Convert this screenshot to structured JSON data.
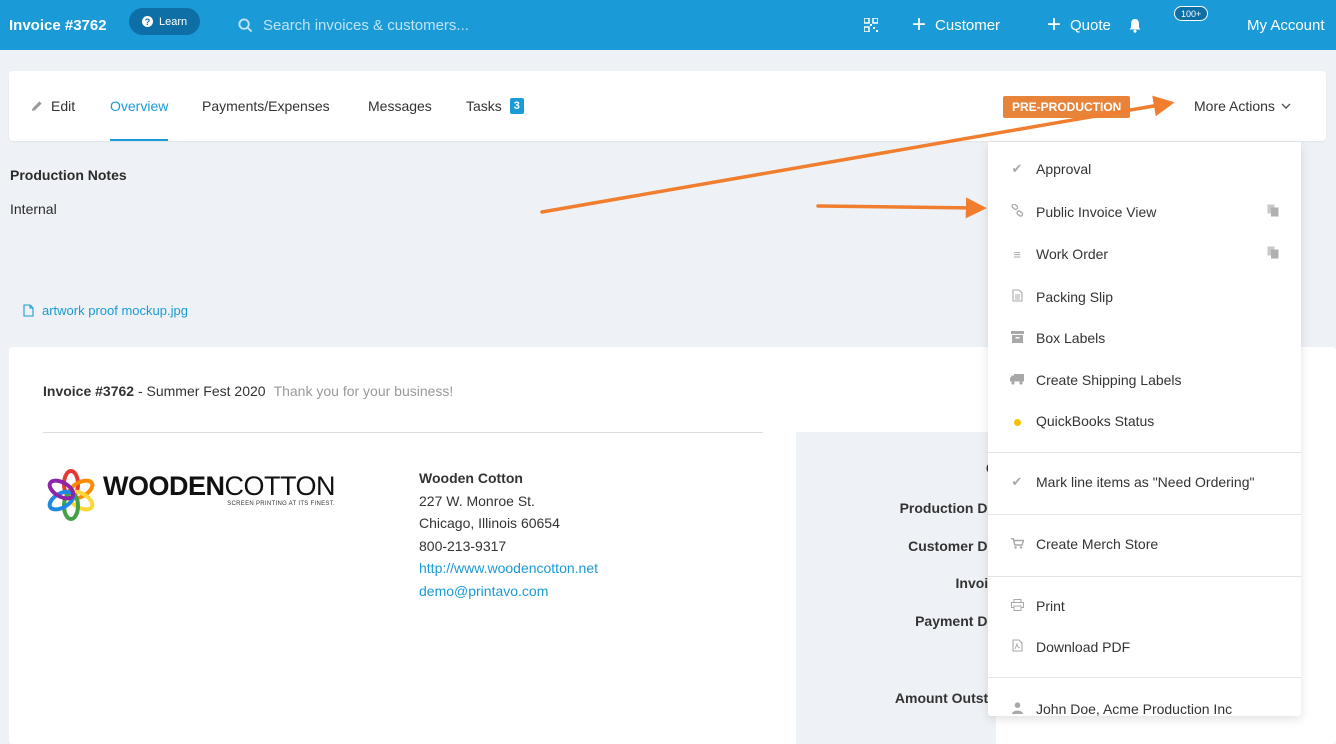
{
  "topbar": {
    "title": "Invoice #3762",
    "learn_label": "Learn",
    "search_placeholder": "Search invoices & customers...",
    "customer_label": "Customer",
    "quote_label": "Quote",
    "notifications_badge": "100+",
    "account_label": "My Account",
    "plus_icon": "+"
  },
  "tabs": {
    "edit": "Edit",
    "overview": "Overview",
    "payments": "Payments/Expenses",
    "messages": "Messages",
    "tasks": "Tasks",
    "tasks_count": "3",
    "status": "PRE-PRODUCTION",
    "more_actions": "More Actions"
  },
  "production": {
    "title": "Production Notes",
    "value": "Internal",
    "attachment": "artwork proof mockup.jpg"
  },
  "invoice": {
    "number": "Invoice #3762",
    "name": " - Summer Fest 2020",
    "thanks": "Thank you for your business!",
    "logo_word_bold": "WOODEN",
    "logo_word_light": "COTTON",
    "logo_tagline": "SCREEN PRINTING AT ITS FINEST.",
    "company": {
      "name": "Wooden Cotton",
      "address1": "227 W. Monroe St.",
      "address2": "Chicago, Illinois 60654",
      "phone": "800-213-9317",
      "website": "http://www.woodencotton.net",
      "email": "demo@printavo.com"
    },
    "side_labels": {
      "c": "C",
      "production_due": "Production Du",
      "customer_due": "Customer Du",
      "invoice": "Invoic",
      "payment_due": "Payment Du",
      "amount_outstanding": "Amount Outsta"
    }
  },
  "dropdown": {
    "approval": "Approval",
    "public_invoice_view": "Public Invoice View",
    "work_order": "Work Order",
    "packing_slip": "Packing Slip",
    "box_labels": "Box Labels",
    "create_shipping_labels": "Create Shipping Labels",
    "quickbooks_status": "QuickBooks Status",
    "mark_need_ordering": "Mark line items as \"Need Ordering\"",
    "create_merch_store": "Create Merch Store",
    "print": "Print",
    "download_pdf": "Download PDF",
    "user": "John Doe, Acme Production Inc"
  },
  "colors": {
    "topbar": "#1a9ad6",
    "status_pill": "#e8833a",
    "annotation_arrow": "#f07e2e",
    "quickbooks_dot": "#f2c200"
  }
}
